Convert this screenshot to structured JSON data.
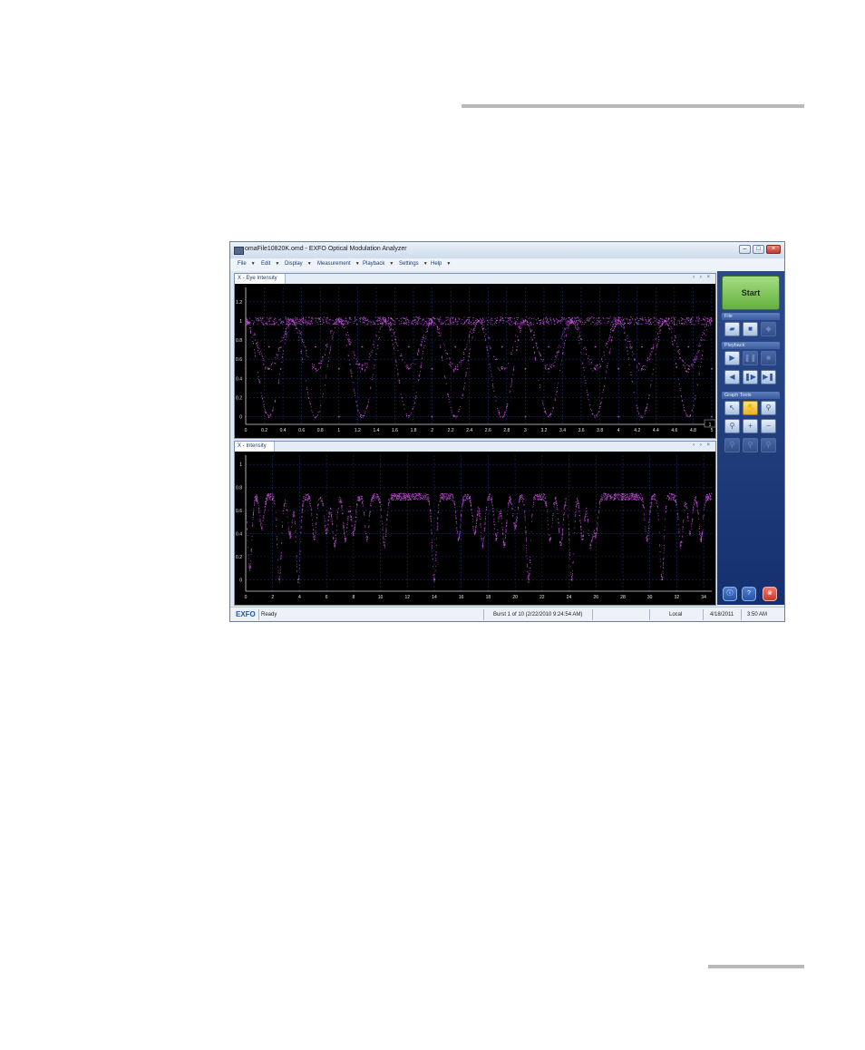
{
  "window": {
    "title": "omaFile10820K.omd - EXFO Optical Modulation Analyzer"
  },
  "menu": [
    "File",
    "Edit",
    "Display",
    "Measurement",
    "Playback",
    "Settings",
    "Help"
  ],
  "panels": {
    "eye": {
      "tab": "X - Eye Intensity",
      "corner_label": "1"
    },
    "intensity": {
      "tab": "X - Intensity"
    }
  },
  "side": {
    "start_label": "Start",
    "groups": {
      "file": "File",
      "playback": "Playback",
      "graph_tools": "Graph Tools"
    }
  },
  "status": {
    "brand": "EXFO",
    "state": "Ready",
    "burst": "Burst 1 of 10 (2/22/2010 9:24:54 AM)",
    "location": "Local",
    "date": "4/18/2011",
    "time": "3:50 AM"
  },
  "colors": {
    "trace": "#c04fd8",
    "grid": "#1b2d74",
    "axis": "#d8d8d8",
    "accent": "#1f57b0"
  },
  "icons": {
    "file": [
      "open-folder-icon",
      "save-disk-icon",
      "eraser-icon"
    ],
    "playback": [
      "play-icon",
      "pause-icon",
      "stop-icon",
      "step-back-icon",
      "step-icon",
      "skip-end-icon"
    ],
    "graph_tools": [
      "pointer-icon",
      "hand-pan-icon",
      "zoom-icon",
      "zoom-region-icon",
      "zoom-in-icon",
      "zoom-out-icon",
      "zoom-a-icon",
      "zoom-b-icon",
      "zoom-c-icon"
    ],
    "bottom": [
      "info-icon",
      "help-icon",
      "exit-icon"
    ]
  },
  "chart_data": [
    {
      "type": "scatter",
      "x_ticks": [
        "0",
        "0.2",
        "0.4",
        "0.6",
        "0.8",
        "1",
        "1.2",
        "1.4",
        "1.6",
        "1.8",
        "2",
        "2.2",
        "2.4",
        "2.6",
        "2.8",
        "3",
        "3.2",
        "3.4",
        "3.6",
        "3.8",
        "4",
        "4.2",
        "4.4",
        "4.6",
        "4.8",
        "5"
      ],
      "y_ticks": [
        "0",
        "0.2",
        "0.4",
        "0.6",
        "0.8",
        "1",
        "1.2"
      ],
      "xlim": [
        0,
        5
      ],
      "ylim": [
        -0.08,
        1.35
      ],
      "series": [
        {
          "x": [
            0,
            0.25,
            0.5,
            0.75,
            1,
            1.25,
            1.5,
            1.75,
            2,
            2.25,
            2.5,
            2.75,
            3,
            3.25,
            3.5,
            3.75,
            4,
            4.25,
            4.5,
            4.75,
            5
          ],
          "y": [
            0.5,
            0.73,
            1.0,
            0.73,
            0.5,
            0.73,
            1.0,
            0.73,
            0.5,
            0.73,
            1.0,
            0.73,
            0.5,
            0.73,
            1.0,
            0.73,
            0.5,
            0.73,
            1.0,
            0.73,
            0.5
          ]
        },
        {
          "x": [
            0,
            0.25,
            0.5,
            0.75,
            1,
            1.25,
            1.5,
            1.75,
            2,
            2.25,
            2.5,
            2.75,
            3,
            3.25,
            3.5,
            3.75,
            4,
            4.25,
            4.5,
            4.75,
            5
          ],
          "y": [
            0.0,
            0.5,
            1.0,
            0.5,
            0.0,
            0.5,
            1.0,
            0.5,
            0.0,
            0.5,
            1.0,
            0.5,
            0.0,
            0.5,
            1.0,
            0.5,
            0.0,
            0.5,
            1.0,
            0.5,
            0.0
          ]
        },
        {
          "x": [
            0,
            0.5,
            1,
            1.5,
            2,
            2.5,
            3,
            3.5,
            4,
            4.5,
            5
          ],
          "y": [
            1.0,
            1.0,
            1.0,
            1.0,
            1.0,
            1.0,
            1.0,
            1.0,
            1.0,
            1.0,
            1.0
          ]
        }
      ],
      "grid": true
    },
    {
      "type": "scatter",
      "x_ticks": [
        "0",
        "2",
        "4",
        "6",
        "8",
        "10",
        "12",
        "14",
        "16",
        "18",
        "20",
        "22",
        "24",
        "26",
        "28",
        "30",
        "32",
        "34"
      ],
      "y_ticks": [
        "0",
        "0.2",
        "0.4",
        "0.6",
        "0.8",
        "1"
      ],
      "xlim": [
        0,
        34.6
      ],
      "ylim": [
        -0.1,
        1.08
      ],
      "base": 0.72,
      "dips": [
        [
          0.3,
          0.1
        ],
        [
          1.2,
          0.45
        ],
        [
          2.5,
          0.0
        ],
        [
          3.3,
          0.38
        ],
        [
          3.9,
          0.0
        ],
        [
          5.1,
          0.35
        ],
        [
          6.0,
          0.4
        ],
        [
          6.6,
          0.3
        ],
        [
          7.4,
          0.35
        ],
        [
          8.0,
          0.4
        ],
        [
          9.0,
          0.35
        ],
        [
          10.3,
          0.3
        ],
        [
          14.0,
          0.0
        ],
        [
          15.8,
          0.35
        ],
        [
          17.0,
          0.4
        ],
        [
          17.6,
          0.3
        ],
        [
          18.6,
          0.35
        ],
        [
          19.2,
          0.3
        ],
        [
          20.0,
          0.45
        ],
        [
          21.0,
          0.0
        ],
        [
          22.6,
          0.35
        ],
        [
          23.4,
          0.3
        ],
        [
          24.2,
          0.0
        ],
        [
          25.0,
          0.35
        ],
        [
          25.6,
          0.3
        ],
        [
          26.0,
          0.4
        ],
        [
          29.8,
          0.35
        ],
        [
          30.9,
          0.0
        ],
        [
          32.3,
          0.3
        ],
        [
          33.0,
          0.4
        ],
        [
          33.8,
          0.35
        ]
      ],
      "grid": true
    }
  ]
}
